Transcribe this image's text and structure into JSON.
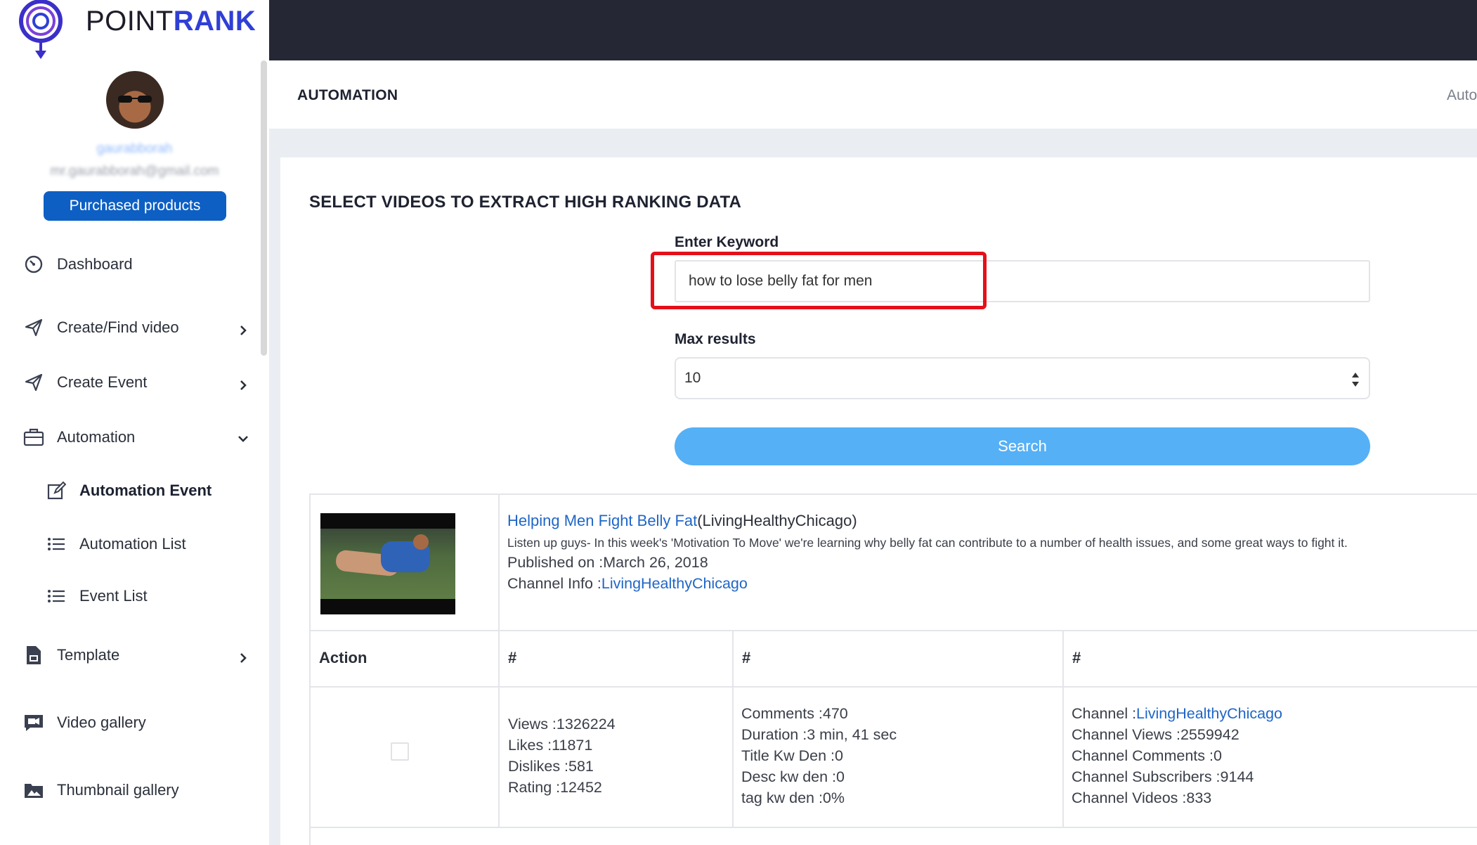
{
  "brand": {
    "name_part1": "POINT",
    "name_part2": "RANK",
    "color": "#2f3fd6"
  },
  "user": {
    "name": "gaurabborah",
    "email": "mr.gaurabborah@gmail.com",
    "purchased_label": "Purchased products"
  },
  "sidebar": {
    "items": [
      {
        "label": "Dashboard",
        "icon": "dashboard-icon"
      },
      {
        "label": "Create/Find video",
        "icon": "send-icon",
        "chevron": "chevron-right-icon"
      },
      {
        "label": "Create Event",
        "icon": "send-icon",
        "chevron": "chevron-right-icon"
      },
      {
        "label": "Automation",
        "icon": "briefcase-icon",
        "chevron": "chevron-down-icon"
      },
      {
        "label": "Automation Event",
        "icon": "edit-icon",
        "active": true
      },
      {
        "label": "Automation List",
        "icon": "list-icon"
      },
      {
        "label": "Event List",
        "icon": "list-icon"
      },
      {
        "label": "Template",
        "icon": "file-icon",
        "chevron": "chevron-right-icon"
      },
      {
        "label": "Video gallery",
        "icon": "video-icon"
      },
      {
        "label": "Thumbnail gallery",
        "icon": "image-icon"
      }
    ]
  },
  "header": {
    "title": "AUTOMATION",
    "right_text": "Auto"
  },
  "form": {
    "section_title": "SELECT VIDEOS TO EXTRACT HIGH RANKING DATA",
    "keyword_label": "Enter Keyword",
    "keyword_value": "how to lose belly fat for men",
    "max_label": "Max results",
    "max_value": "10",
    "search_label": "Search"
  },
  "result": {
    "title_link": "Helping Men Fight Belly Fat",
    "title_suffix": "(LivingHealthyChicago)",
    "description": "Listen up guys- In this week's 'Motivation To Move' we're learning why belly fat can contribute to a number of health issues, and some great ways to fight it.",
    "published": "Published on :March 26, 2018",
    "channel_info_prefix": "Channel Info :",
    "channel_info_link": "LivingHealthyChicago",
    "headers": [
      "Action",
      "#",
      "#",
      "#"
    ],
    "stats_col1": [
      "Views :1326224",
      "Likes :11871",
      "Dislikes :581",
      "Rating :12452"
    ],
    "stats_col2": [
      "Comments :470",
      "Duration :3 min, 41 sec",
      "Title Kw Den :0",
      "Desc kw den :0",
      "tag kw den :0%"
    ],
    "channel_prefix": "Channel :",
    "channel_link": "LivingHealthyChicago",
    "stats_col3": [
      "Channel Views :2559942",
      "Channel Comments :0",
      "Channel Subscribers :9144",
      "Channel Videos :833"
    ]
  },
  "colors": {
    "topbar": "#252834",
    "primary_button": "#0d5fc4",
    "search_button": "#55b0f6",
    "highlight": "#e3101a",
    "link": "#1f66c7"
  }
}
